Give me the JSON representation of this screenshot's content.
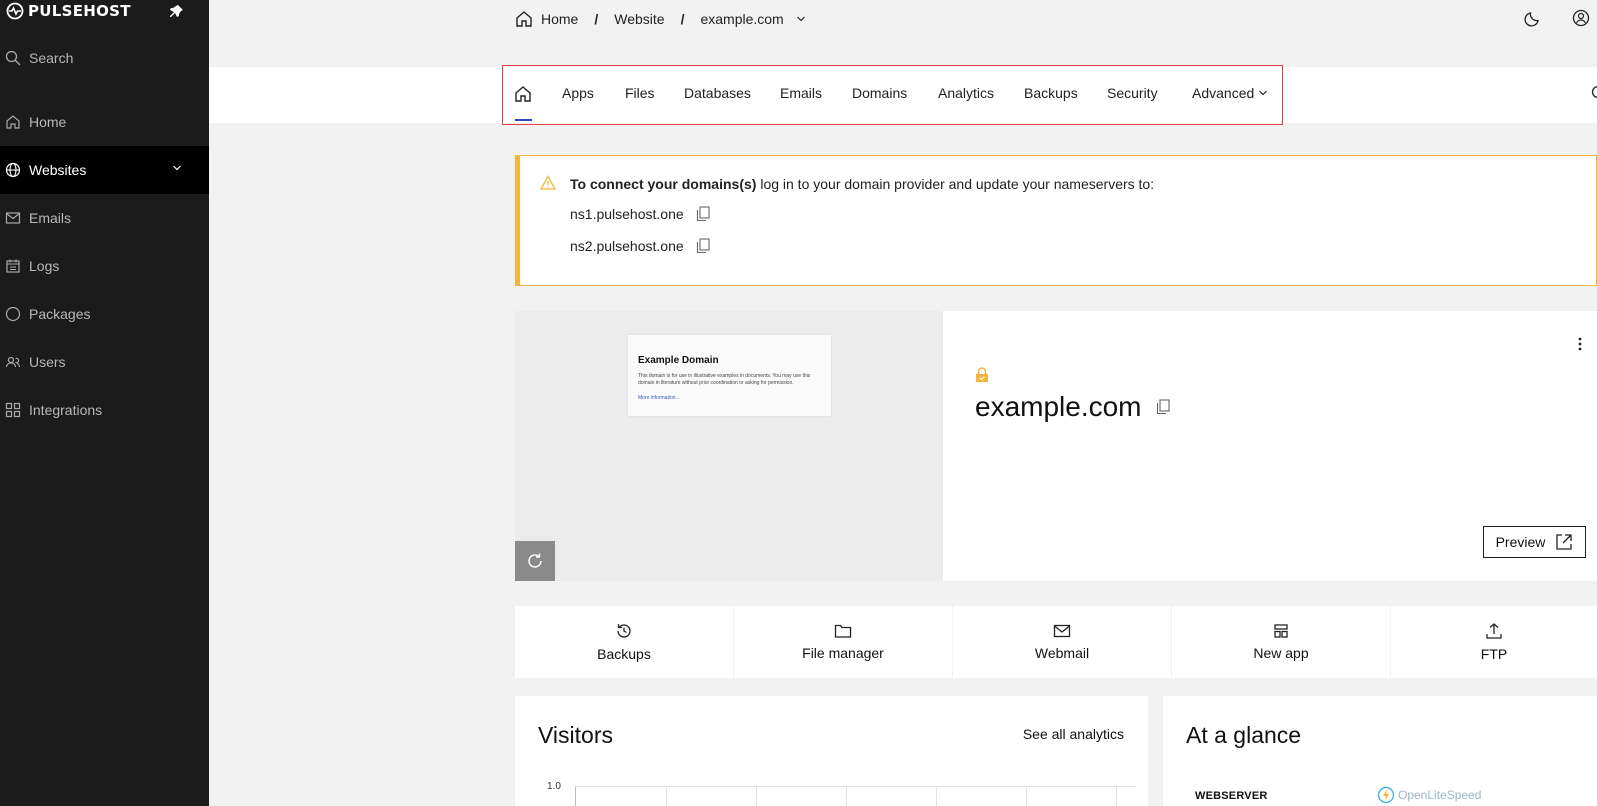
{
  "brand": {
    "name": "PULSEHOST"
  },
  "sidebar": {
    "search_label": "Search",
    "items": [
      {
        "label": "Home",
        "icon": "home-icon"
      },
      {
        "label": "Websites",
        "icon": "globe-icon",
        "active": true
      },
      {
        "label": "Emails",
        "icon": "mail-icon"
      },
      {
        "label": "Logs",
        "icon": "calendar-icon"
      },
      {
        "label": "Packages",
        "icon": "circle-icon"
      },
      {
        "label": "Users",
        "icon": "users-icon"
      },
      {
        "label": "Integrations",
        "icon": "grid-icon"
      }
    ]
  },
  "breadcrumb": {
    "home": "Home",
    "sep": "/",
    "section": "Website",
    "current": "example.com"
  },
  "tabs": [
    "Apps",
    "Files",
    "Databases",
    "Emails",
    "Domains",
    "Analytics",
    "Backups",
    "Security",
    "Advanced"
  ],
  "alert": {
    "title_bold": "To connect your domains(s)",
    "title_rest": " log in to your domain provider and update your nameservers to:",
    "ns1": "ns1.pulsehost.one",
    "ns2": "ns2.pulsehost.one"
  },
  "site": {
    "domain": "example.com",
    "preview_label": "Preview",
    "thumb_title": "Example Domain",
    "thumb_text": "This domain is for use in illustrative examples in documents. You may use this domain in literature without prior coordination or asking for permission.",
    "thumb_link": "More information..."
  },
  "quick_actions": [
    {
      "label": "Backups",
      "icon": "history-icon"
    },
    {
      "label": "File manager",
      "icon": "folder-icon"
    },
    {
      "label": "Webmail",
      "icon": "mail-icon"
    },
    {
      "label": "New app",
      "icon": "layout-icon"
    },
    {
      "label": "FTP",
      "icon": "upload-icon"
    }
  ],
  "visitors": {
    "title": "Visitors",
    "link": "See all analytics",
    "y_tick": "1.0"
  },
  "glance": {
    "title": "At a glance",
    "webserver_label": "WEBSERVER",
    "webserver_value": "OpenLiteSpeed"
  },
  "colors": {
    "sidebar_bg": "#1b1b1b",
    "alert_accent": "#f3b53d",
    "highlight_border": "#e3404b",
    "tab_underline": "#2a48c8"
  }
}
